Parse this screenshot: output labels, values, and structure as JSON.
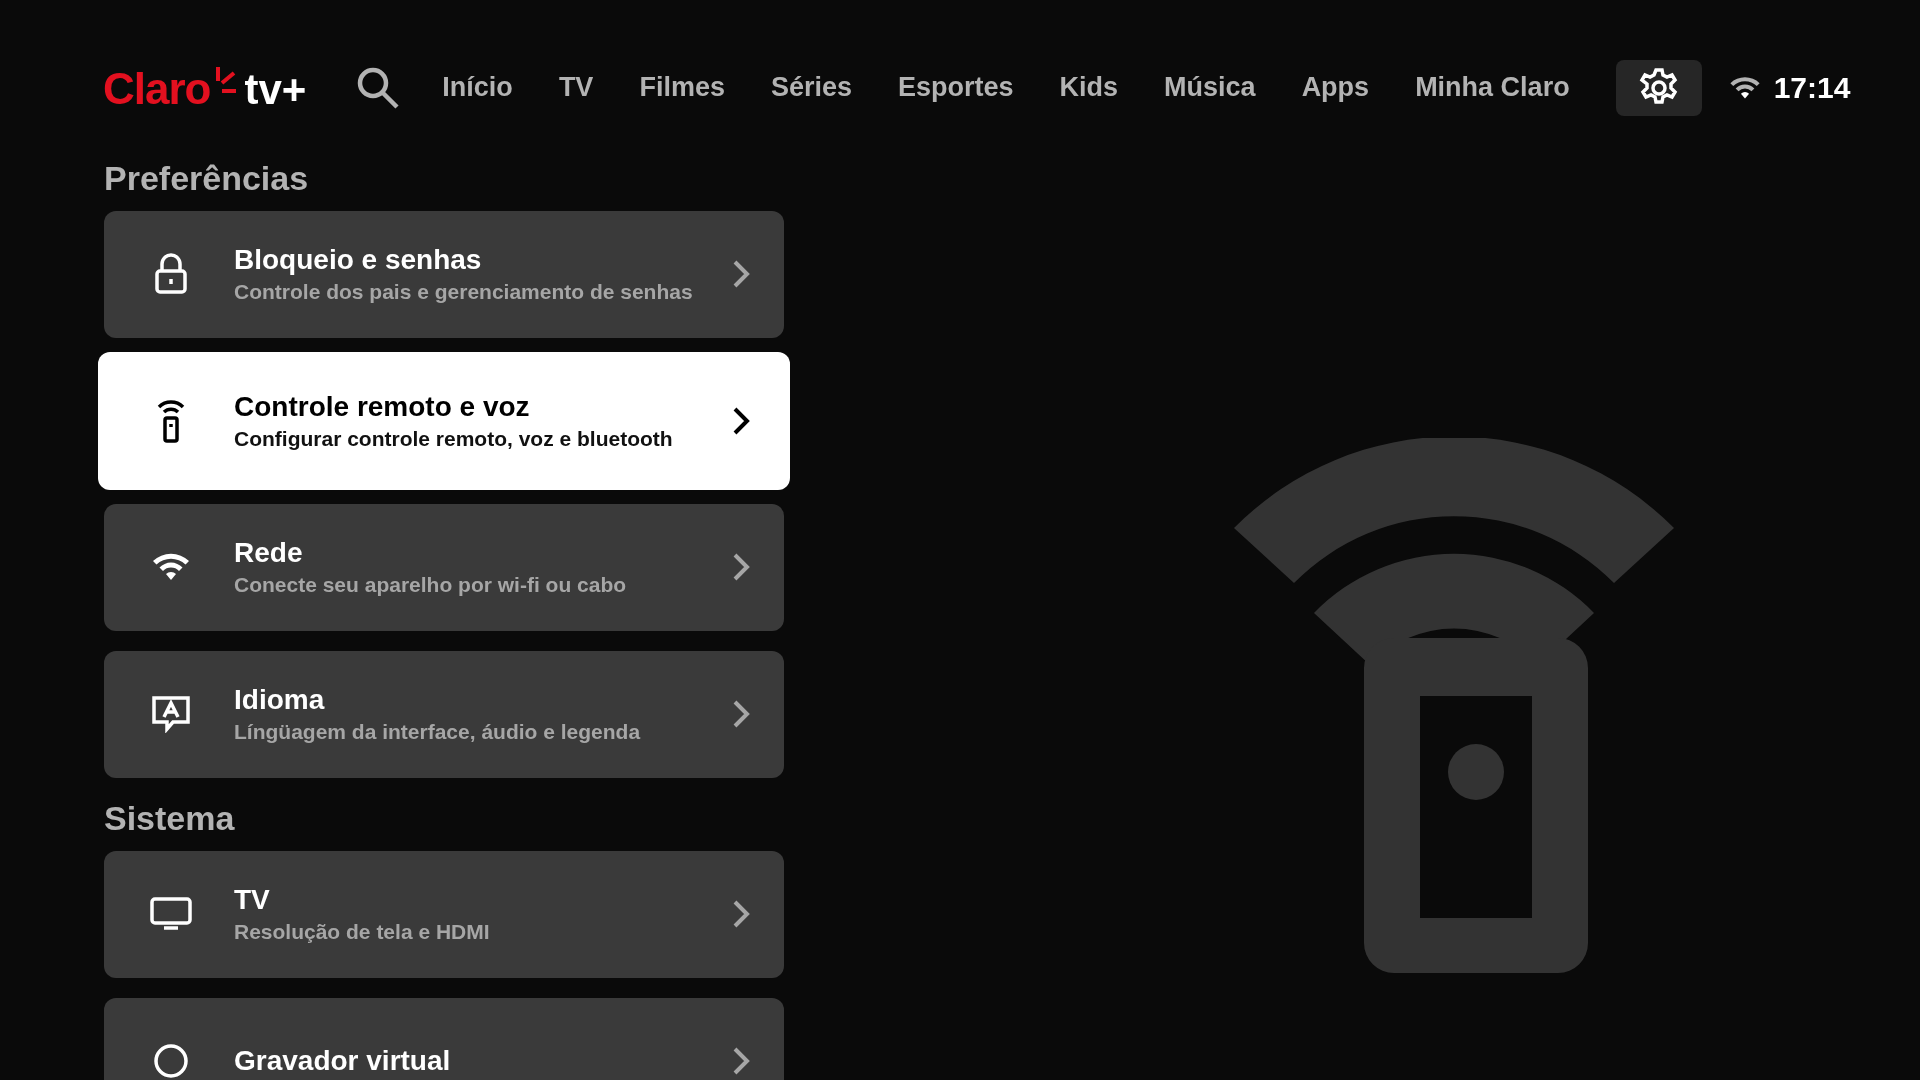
{
  "header": {
    "logo": {
      "brand": "Claro",
      "product": "tv+"
    },
    "nav": [
      {
        "label": "Início",
        "selected": false
      },
      {
        "label": "TV",
        "selected": false
      },
      {
        "label": "Filmes",
        "selected": false
      },
      {
        "label": "Séries",
        "selected": false
      },
      {
        "label": "Esportes",
        "selected": false
      },
      {
        "label": "Kids",
        "selected": false
      },
      {
        "label": "Música",
        "selected": false
      },
      {
        "label": "Apps",
        "selected": false
      },
      {
        "label": "Minha Claro",
        "selected": false
      }
    ],
    "settings": {
      "selected": true
    },
    "time": "17:14"
  },
  "sections": [
    {
      "title": "Preferências",
      "items": [
        {
          "kind": "lock",
          "title": "Bloqueio e senhas",
          "subtitle": "Controle dos pais e gerenciamento de senhas",
          "selected": false
        },
        {
          "kind": "remote",
          "title": "Controle remoto e voz",
          "subtitle": "Configurar controle remoto, voz e bluetooth",
          "selected": true
        },
        {
          "kind": "wifi",
          "title": "Rede",
          "subtitle": "Conecte seu aparelho por wi-fi ou cabo",
          "selected": false
        },
        {
          "kind": "language",
          "title": "Idioma",
          "subtitle": "Língüagem da interface, áudio e legenda",
          "selected": false
        }
      ]
    },
    {
      "title": "Sistema",
      "items": [
        {
          "kind": "tv",
          "title": "TV",
          "subtitle": "Resolução de tela e HDMI",
          "selected": false
        },
        {
          "kind": "recorder",
          "title": "Gravador virtual",
          "selected": false
        }
      ]
    }
  ]
}
